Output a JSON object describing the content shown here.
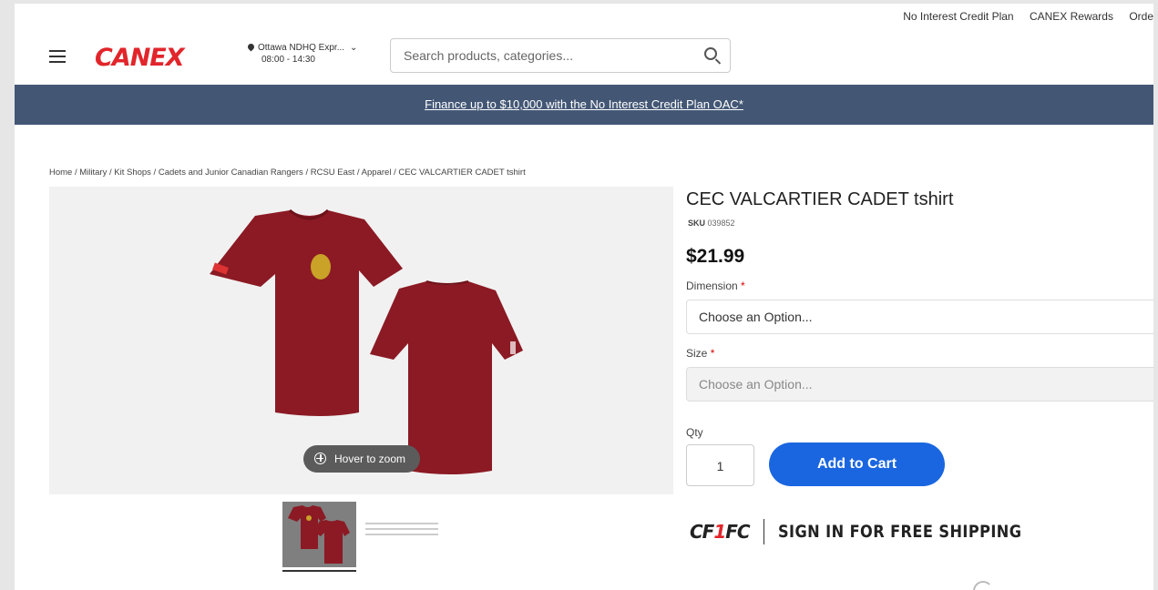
{
  "top_links": [
    "No Interest Credit Plan",
    "CANEX Rewards",
    "Orde"
  ],
  "header": {
    "logo_text": "CANEX",
    "store_name": "Ottawa NDHQ Expr...",
    "store_hours": "08:00 - 14:30",
    "search_placeholder": "Search products, categories..."
  },
  "banner": {
    "text": "Finance up to $10,000 with the No Interest Credit Plan OAC*"
  },
  "breadcrumb": "Home / Military / Kit Shops / Cadets and Junior Canadian Rangers / RCSU East / Apparel / CEC VALCARTIER CADET tshirt",
  "gallery": {
    "zoom_label": "Hover to zoom"
  },
  "product": {
    "title": "CEC VALCARTIER CADET tshirt",
    "sku_label": "SKU",
    "sku": "039852",
    "price": "$21.99",
    "dimension_label": "Dimension",
    "dimension_value": "Choose an Option...",
    "size_label": "Size",
    "size_value": "Choose an Option...",
    "required_marker": "*",
    "qty_label": "Qty",
    "qty_value": "1",
    "add_to_cart": "Add to Cart"
  },
  "promo": {
    "cfone_prefix": "CF",
    "cfone_one": "1",
    "cfone_suffix": "FC",
    "signin_text": "SIGN IN FOR FREE SHIPPING"
  },
  "colors": {
    "brand_red": "#e1252b",
    "banner_bg": "#435775",
    "cart_blue": "#1a66e0",
    "shirt_maroon": "#8b1a24"
  }
}
